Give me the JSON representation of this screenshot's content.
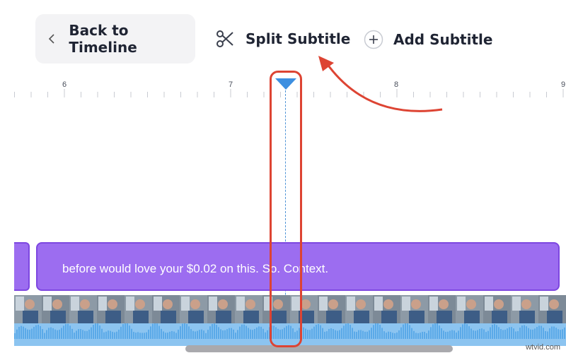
{
  "toolbar": {
    "back_label": "Back to Timeline",
    "split_label": "Split Subtitle",
    "add_label": "Add Subtitle"
  },
  "ruler": {
    "marks": [
      {
        "label": "6",
        "left": 0
      },
      {
        "label": "7",
        "left": 0
      },
      {
        "label": "8",
        "left": 0
      },
      {
        "label": "9",
        "left": 0
      }
    ]
  },
  "subtitles": {
    "main_text": "before would love your $0.02 on this. So. Context."
  },
  "watermark": "wtvid.com",
  "colors": {
    "accent": "#9c6df0",
    "playhead": "#3d8fe0",
    "annotation": "#dd4433",
    "audio": "#8cc4f0"
  }
}
